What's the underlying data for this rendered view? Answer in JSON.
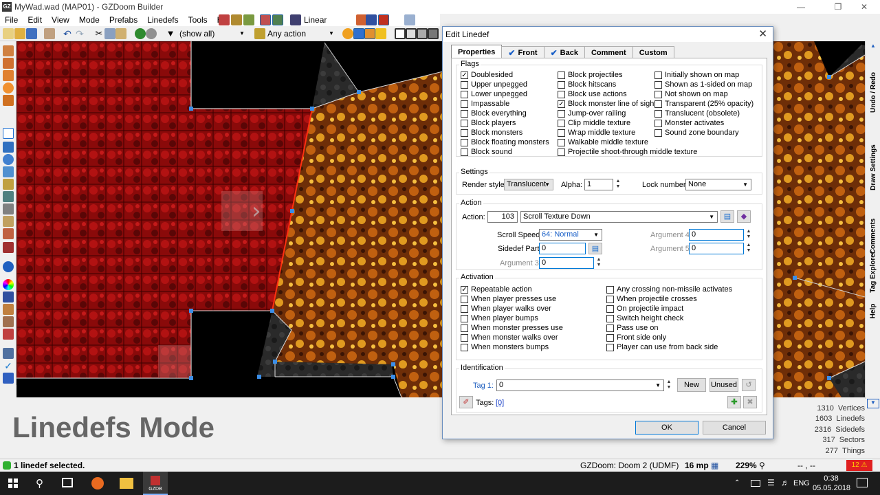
{
  "window": {
    "title": "MyWad.wad (MAP01) - GZDoom Builder",
    "app_icon": "GZ"
  },
  "menu": [
    "File",
    "Edit",
    "View",
    "Mode",
    "Prefabs",
    "Linedefs",
    "Tools",
    "Help"
  ],
  "toolbar": {
    "filter_label": "(show all)",
    "action_filter": "Any action",
    "interpolation": "Linear"
  },
  "right_dock": [
    "Undo / Redo",
    "Draw Settings",
    "Comments",
    "Tag Explorer",
    "Help"
  ],
  "mode_title": "Linedefs Mode",
  "stats": [
    {
      "count": "1310",
      "label": "Vertices"
    },
    {
      "count": "1603",
      "label": "Linedefs"
    },
    {
      "count": "2316",
      "label": "Sidedefs"
    },
    {
      "count": "317",
      "label": "Sectors"
    },
    {
      "count": "277",
      "label": "Things"
    }
  ],
  "status": {
    "message": "1 linedef selected.",
    "engine": "GZDoom: Doom 2 (UDMF)",
    "grid": "16 mp",
    "zoom": "229%",
    "coords": "-- , --",
    "warnings": "12"
  },
  "taskbar": {
    "lang": "ENG",
    "time": "0:38",
    "date": "05.05.2018",
    "gzdb": "GZDB"
  },
  "dialog": {
    "title": "Edit Linedef",
    "tabs": [
      {
        "label": "Properties",
        "checked": false
      },
      {
        "label": "Front",
        "checked": true
      },
      {
        "label": "Back",
        "checked": true
      },
      {
        "label": "Comment",
        "checked": false
      },
      {
        "label": "Custom",
        "checked": false
      }
    ],
    "flags_title": "Flags",
    "flags": [
      [
        {
          "label": "Doublesided",
          "checked": true
        },
        {
          "label": "Upper unpegged",
          "checked": false
        },
        {
          "label": "Lower unpegged",
          "checked": false
        },
        {
          "label": "Impassable",
          "checked": false
        },
        {
          "label": "Block everything",
          "checked": false
        },
        {
          "label": "Block players",
          "checked": false
        },
        {
          "label": "Block monsters",
          "checked": false
        },
        {
          "label": "Block floating monsters",
          "checked": false
        },
        {
          "label": "Block sound",
          "checked": false
        }
      ],
      [
        {
          "label": "Block projectiles",
          "checked": false
        },
        {
          "label": "Block hitscans",
          "checked": false
        },
        {
          "label": "Block use actions",
          "checked": false
        },
        {
          "label": "Block monster line of sight",
          "checked": true
        },
        {
          "label": "Jump-over railing",
          "checked": false
        },
        {
          "label": "Clip middle texture",
          "checked": false
        },
        {
          "label": "Wrap middle texture",
          "checked": false
        },
        {
          "label": "Walkable middle texture",
          "checked": false
        },
        {
          "label": "Projectile shoot-through middle texture",
          "checked": false
        }
      ],
      [
        {
          "label": "Initially shown on map",
          "checked": false
        },
        {
          "label": "Shown as 1-sided on map",
          "checked": false
        },
        {
          "label": "Not shown on map",
          "checked": false
        },
        {
          "label": "Transparent (25% opacity)",
          "checked": false
        },
        {
          "label": "Translucent (obsolete)",
          "checked": false
        },
        {
          "label": "Monster activates",
          "checked": false
        },
        {
          "label": "Sound zone boundary",
          "checked": false
        }
      ]
    ],
    "settings_title": "Settings",
    "render_style_label": "Render style:",
    "render_style": "Translucent",
    "alpha_label": "Alpha:",
    "alpha": "1",
    "lock_label": "Lock number:",
    "lock": "None",
    "action_title": "Action",
    "action_label": "Action:",
    "action_num": "103",
    "action_name": "Scroll Texture Down",
    "scroll_speed_label": "Scroll Speed:",
    "scroll_speed": "64: Normal",
    "sidedef_part_label": "Sidedef Part:",
    "sidedef_part": "0",
    "arg3_label": "Argument 3:",
    "arg3": "0",
    "arg4_label": "Argument 4:",
    "arg4": "0",
    "arg5_label": "Argument 5:",
    "arg5": "0",
    "activation_title": "Activation",
    "activation": [
      [
        {
          "label": "Repeatable action",
          "checked": true
        },
        {
          "label": "When player presses use",
          "checked": false
        },
        {
          "label": "When player walks over",
          "checked": false
        },
        {
          "label": "When player bumps",
          "checked": false
        },
        {
          "label": "When monster presses use",
          "checked": false
        },
        {
          "label": "When monster walks over",
          "checked": false
        },
        {
          "label": "When monsters bumps",
          "checked": false
        }
      ],
      [
        {
          "label": "Any crossing non-missile activates",
          "checked": false
        },
        {
          "label": "When projectile crosses",
          "checked": false
        },
        {
          "label": "On projectile impact",
          "checked": false
        },
        {
          "label": "Switch height check",
          "checked": false
        },
        {
          "label": "Pass use on",
          "checked": false
        },
        {
          "label": "Front side only",
          "checked": false
        },
        {
          "label": "Player can use from back side",
          "checked": false
        }
      ]
    ],
    "ident_title": "Identification",
    "tag_label": "Tag 1:",
    "tag": "0",
    "new_btn": "New",
    "unused_btn": "Unused",
    "tags_label": "Tags:",
    "tags_link": "[0]",
    "ok": "OK",
    "cancel": "Cancel"
  }
}
